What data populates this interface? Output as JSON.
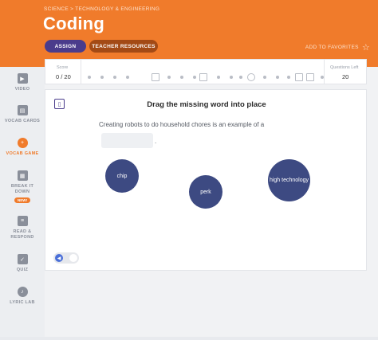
{
  "header": {
    "breadcrumb": "SCIENCE > TECHNOLOGY & ENGINEERING",
    "title": "Coding",
    "assign_label": "ASSIGN",
    "teacher_label": "TEACHER RESOURCES",
    "favorite_label": "ADD TO FAVORITES",
    "colors": {
      "header_bg": "#f07b2b",
      "assign_bg": "#4a3c8c",
      "teacher_bg": "#a34a15"
    }
  },
  "sidebar": {
    "items": [
      {
        "label": "VIDEO",
        "icon": "video-icon"
      },
      {
        "label": "VOCAB CARDS",
        "icon": "vocab-cards-icon"
      },
      {
        "label": "VOCAB GAME",
        "icon": "vocab-game-icon",
        "active": true
      },
      {
        "label": "BREAK IT DOWN",
        "icon": "break-it-down-icon",
        "badge": "NEW!"
      },
      {
        "label": "READ & RESPOND",
        "icon": "read-respond-icon"
      },
      {
        "label": "QUIZ",
        "icon": "quiz-icon"
      },
      {
        "label": "LYRIC LAB",
        "icon": "lyric-lab-icon"
      }
    ]
  },
  "scorebar": {
    "score_label": "Score",
    "score_value": "0 / 20",
    "questions_left_label": "Questions Left",
    "questions_left_value": "20"
  },
  "game": {
    "instruction": "Drag the missing word into place",
    "sentence": "Creating robots to do household chores is an example of a",
    "sentence_end": ".",
    "words": [
      "chip",
      "perk",
      "high technology"
    ],
    "word_color": "#3d4a82"
  },
  "audio": {
    "icon": "speaker-icon",
    "toggle_on": false
  }
}
